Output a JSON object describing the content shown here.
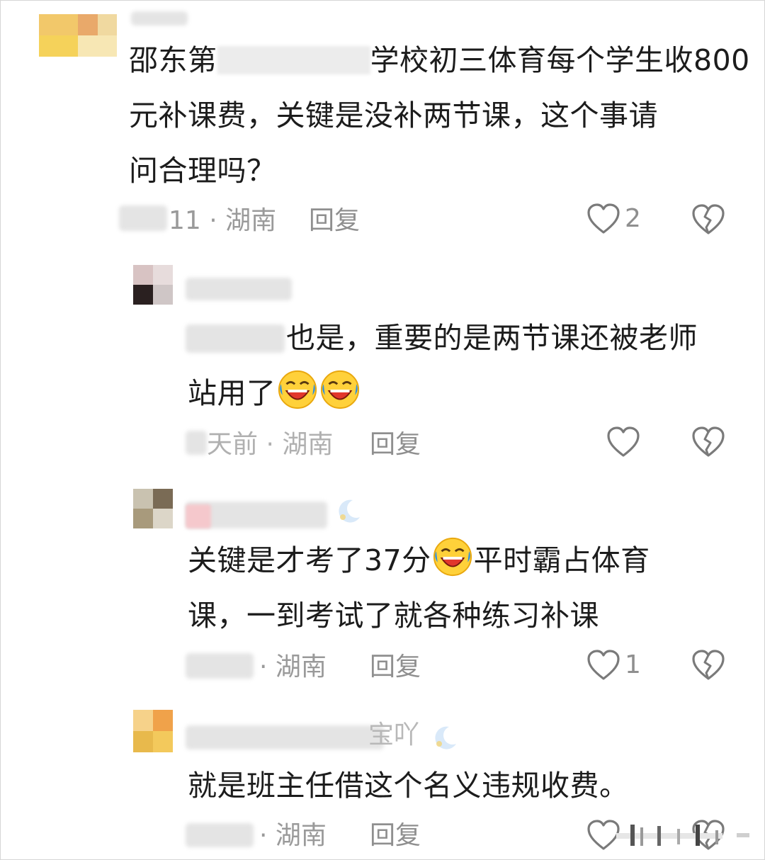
{
  "comments": [
    {
      "text_lines": [
        "邵东第",
        "学校初三体育每个学生收800",
        "元补课费，关键是没补两节课，这个事请",
        "问合理吗？"
      ],
      "meta": "11 · 湖南",
      "reply": "回复",
      "likes": "2"
    },
    {
      "text_lines": [
        "也是，重要的是两节课还被老师",
        "站用了"
      ],
      "meta": "天前 · 湖南",
      "reply": "回复",
      "likes": ""
    },
    {
      "text_lines": [
        "关键是才考了37分",
        "平时霸占体育",
        "课，一到考试了就各种练习补课"
      ],
      "meta": "· 湖南",
      "reply": "回复",
      "likes": "1"
    },
    {
      "username_suffix": "宝吖",
      "text_lines": [
        "就是班主任借这个名义违规收费。"
      ],
      "meta": "· 湖南",
      "reply": "回复",
      "likes": ""
    }
  ],
  "icons": {
    "like": "heart-outline-icon",
    "dislike": "broken-heart-icon",
    "emoji": "laughing-crying-emoji"
  },
  "colors": {
    "text": "#1c1c1c",
    "meta": "#9a9a9a",
    "icon": "#7a7a7a"
  }
}
